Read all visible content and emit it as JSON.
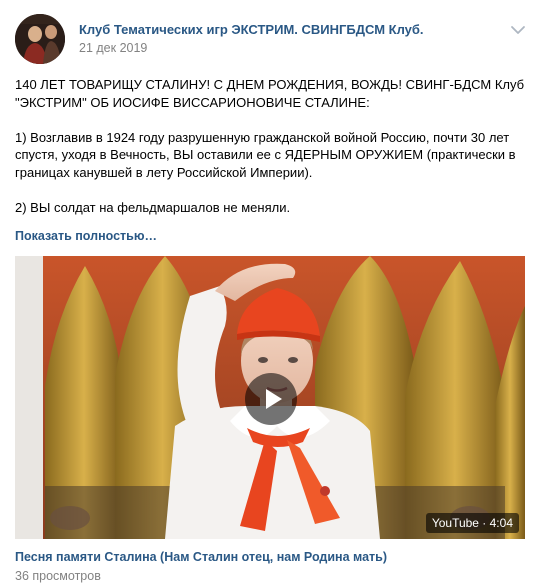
{
  "header": {
    "group_name": "Клуб Тематических игр ЭКСТРИМ. СВИНГБДСМ Клуб.",
    "date": "21 дек 2019",
    "avatar_icon": "group-avatar",
    "menu_icon": "chevron-down-icon"
  },
  "post": {
    "paragraphs": [
      "140 ЛЕТ ТОВАРИЩУ СТАЛИНУ! С ДНЕМ РОЖДЕНИЯ, ВОЖДЬ! СВИНГ-БДСМ Клуб \"ЭКСТРИМ\" ОБ ИОСИФЕ ВИССАРИОНОВИЧЕ СТАЛИНЕ:",
      "1) Возглавив в 1924 году разрушенную гражданской войной Россию, почти 30 лет спустя, уходя в Вечность, ВЫ оставили ее с ЯДЕРНЫМ ОРУЖИЕМ (практически в границах канувшей в лету Российской Империи).",
      "2) ВЫ солдат на фельдмаршалов не меняли."
    ],
    "show_more": "Показать полностью…"
  },
  "video": {
    "badge": "YouTube · 4:04",
    "play_icon": "play-icon",
    "title": "Песня памяти Сталина (Нам Сталин отец, нам Родина мать)",
    "views": "36 просмотров"
  },
  "colors": {
    "link": "#2a5885",
    "meta": "#828282",
    "pioneer_red": "#e8451f"
  }
}
